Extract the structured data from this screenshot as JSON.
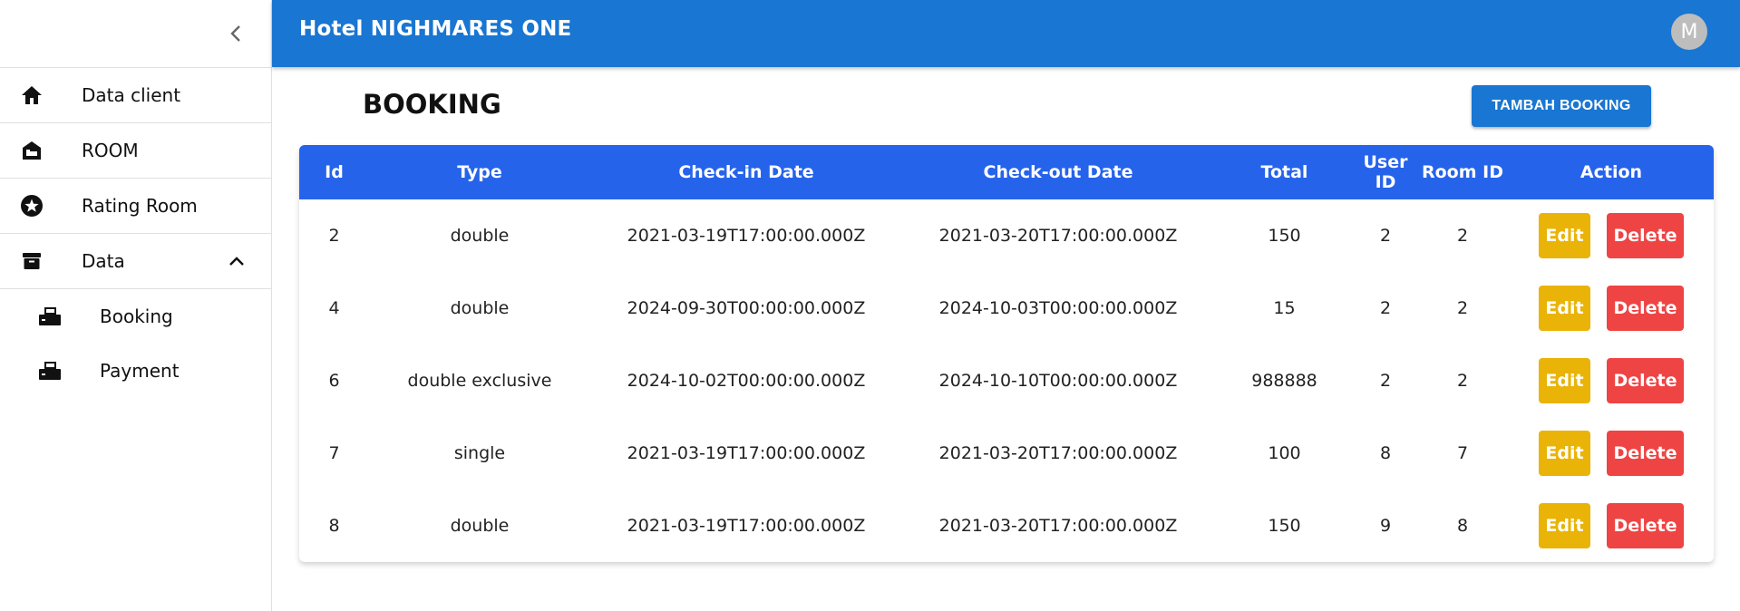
{
  "app": {
    "title": "Hotel NIGHMARES ONE",
    "avatar_initial": "M"
  },
  "sidebar": {
    "items": [
      {
        "label": "Data client",
        "icon": "home-icon"
      },
      {
        "label": "ROOM",
        "icon": "hotel-icon"
      },
      {
        "label": "Rating Room",
        "icon": "star-circle-icon"
      },
      {
        "label": "Data",
        "icon": "archive-icon",
        "expanded": true
      }
    ],
    "subitems": [
      {
        "label": "Booking",
        "icon": "fax-icon"
      },
      {
        "label": "Payment",
        "icon": "fax-icon"
      }
    ]
  },
  "main": {
    "title": "BOOKING",
    "add_button": "TAMBAH BOOKING",
    "table": {
      "headers": [
        "Id",
        "Type",
        "Check-in Date",
        "Check-out Date",
        "Total",
        "User ID",
        "Room ID",
        "Action"
      ],
      "rows": [
        [
          "2",
          "double",
          "2021-03-19T17:00:00.000Z",
          "2021-03-20T17:00:00.000Z",
          "150",
          "2",
          "2"
        ],
        [
          "4",
          "double",
          "2024-09-30T00:00:00.000Z",
          "2024-10-03T00:00:00.000Z",
          "15",
          "2",
          "2"
        ],
        [
          "6",
          "double exclusive",
          "2024-10-02T00:00:00.000Z",
          "2024-10-10T00:00:00.000Z",
          "988888",
          "2",
          "2"
        ],
        [
          "7",
          "single",
          "2021-03-19T17:00:00.000Z",
          "2021-03-20T17:00:00.000Z",
          "100",
          "8",
          "7"
        ],
        [
          "8",
          "double",
          "2021-03-19T17:00:00.000Z",
          "2021-03-20T17:00:00.000Z",
          "150",
          "9",
          "8"
        ]
      ],
      "edit_label": "Edit",
      "delete_label": "Delete"
    }
  },
  "colors": {
    "appbar": "#1976d2",
    "table_header": "#2563eb",
    "edit": "#eab308",
    "delete": "#ef4444"
  }
}
